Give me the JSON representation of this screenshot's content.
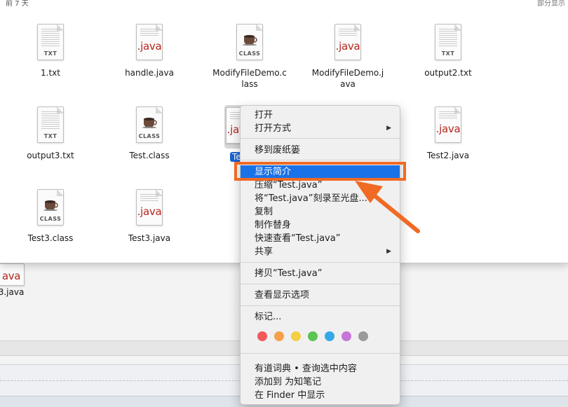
{
  "finder": {
    "section_title": "前 7 天",
    "section_right": "部分显示"
  },
  "files": [
    {
      "name": "1.txt",
      "kind": "txt",
      "tag": "TXT"
    },
    {
      "name": "handle.java",
      "kind": "java",
      "tag": ".java"
    },
    {
      "name": "ModifyFileDemo.class",
      "kind": "class",
      "tag": "CLASS"
    },
    {
      "name": "ModifyFileDemo.java",
      "kind": "java",
      "tag": ".java"
    },
    {
      "name": "output2.txt",
      "kind": "txt",
      "tag": "TXT"
    },
    {
      "name": "output3.txt",
      "kind": "txt",
      "tag": "TXT"
    },
    {
      "name": "Test.class",
      "kind": "class",
      "tag": "CLASS"
    },
    {
      "name": "Te",
      "kind": "java",
      "tag": ".java",
      "selected": true
    },
    {
      "name": "Test2.java",
      "kind": "java",
      "tag": ".java"
    },
    {
      "name": "Test3.class",
      "kind": "class",
      "tag": "CLASS"
    },
    {
      "name": "Test3.java",
      "kind": "java",
      "tag": ".java"
    }
  ],
  "desktop_item": {
    "name": "3.java",
    "tag": "ava"
  },
  "context_menu": {
    "items": [
      {
        "label": "打开"
      },
      {
        "label": "打开方式",
        "submenu": "▶"
      },
      {
        "label": "移到废纸篓"
      },
      {
        "label": "显示简介",
        "highlighted": true
      },
      {
        "label": "压缩“Test.java”"
      },
      {
        "label": "将“Test.java”刻录至光盘..."
      },
      {
        "label": "复制"
      },
      {
        "label": "制作替身"
      },
      {
        "label": "快速查看“Test.java”"
      },
      {
        "label": "共享",
        "submenu": "▶"
      },
      {
        "label": "拷贝“Test.java”"
      },
      {
        "label": "查看显示选项"
      },
      {
        "label": "标记..."
      },
      {
        "label": "有道词典 • 查询选中内容"
      },
      {
        "label": "添加到 为知笔记"
      },
      {
        "label": "在 Finder 中显示"
      }
    ],
    "tag_colors": [
      "#f25a5a",
      "#f7a048",
      "#f4cf45",
      "#5bc452",
      "#35a8e8",
      "#c774d8",
      "#9a9a9a"
    ]
  },
  "colors": {
    "highlight": "#1a72e8",
    "annotation": "#f06a24",
    "java_red": "#b3261e"
  }
}
